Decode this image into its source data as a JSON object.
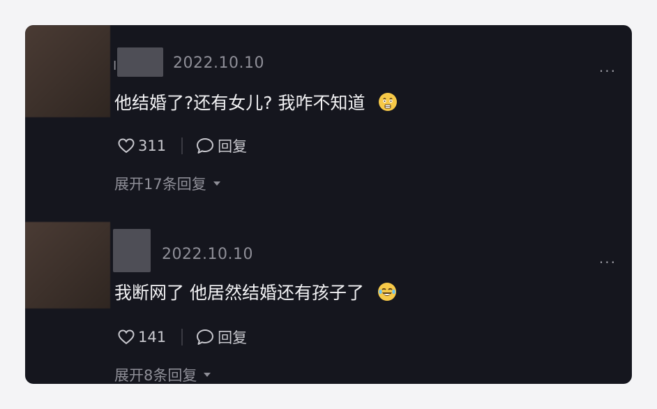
{
  "comments": [
    {
      "date": "2022.10.10",
      "text": "他结婚了?还有女儿? 我咋不知道",
      "emoji": "shocked-face-icon",
      "likes": "311",
      "reply_label": "回复",
      "expand_label": "展开17条回复",
      "more_label": "..."
    },
    {
      "date": "2022.10.10",
      "text": "我断网了 他居然结婚还有孩子了",
      "emoji": "crying-laughing-face-icon",
      "likes": "141",
      "reply_label": "回复",
      "expand_label": "展开8条回复",
      "more_label": "..."
    }
  ],
  "colors": {
    "panel_bg": "#15161e",
    "text_primary": "#f2f2f4",
    "text_secondary": "#8f8f98",
    "emoji_yellow": "#f7c948"
  }
}
